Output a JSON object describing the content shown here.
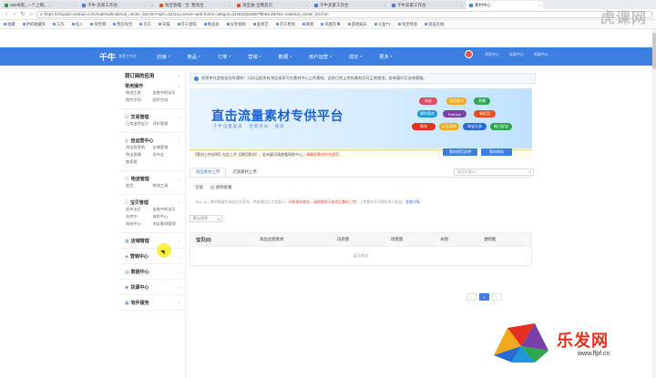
{
  "browser": {
    "tabs": [
      {
        "label": "360导航_一个上网，..",
        "color": "#2b9b3a",
        "active": false
      },
      {
        "label": "千牛-卖家工作台",
        "color": "#3d7fe0",
        "active": false
      },
      {
        "label": "淘宝管理 - 宝: 我淘宝",
        "color": "#e6501f",
        "active": false
      },
      {
        "label": "淘宝通-全网首页",
        "color": "#e6501f",
        "active": false
      },
      {
        "label": "千牛卖家工作台",
        "color": "#3d7fe0",
        "active": false
      },
      {
        "label": "千牛卖家工作台",
        "color": "#3d7fe0",
        "active": false
      },
      {
        "label": "素材中心",
        "color": "#3d7fe0",
        "active": true
      }
    ],
    "url": "https://zhiqulxin.taobao.com/material/material_center_list.htm?spm=a211vu.server-web-home.category.d12622d2d387f8b5a.Z8rf4e=material_center_list.htm",
    "bookmarks": [
      "收藏",
      "手机收藏夹",
      "工作",
      "电入",
      "淘宝网",
      "我的淘宝",
      "京东",
      "天猫",
      "苏宁易购",
      "唯品会",
      "分享视频",
      "爱奇艺",
      "苏宁易购",
      "网易",
      "凤凰军事",
      "游戏娱乐",
      "斗鱼TV",
      "淘宝特卖",
      "国美在线"
    ]
  },
  "app": {
    "logo": "千牛",
    "logo_sub": "卖家工作台",
    "nav": [
      "店铺",
      "商品",
      "订单",
      "营销",
      "数据",
      "用户运营",
      "成长",
      "更多"
    ],
    "right_links": [
      "消息中心",
      "卖家中心",
      "帮助中心"
    ]
  },
  "sidebar": {
    "head": "我订阅的应用",
    "groups": [
      {
        "title": "常用操作",
        "icon": "",
        "links": [
          "物流工具",
          "出售中的宝贝",
          "图片空间",
          "图片空间"
        ]
      },
      {
        "title": "交易管理",
        "icon": "☷",
        "links": [
          "已卖出的宝贝",
          "评价管理"
        ]
      },
      {
        "title": "自运营中心",
        "icon": "◎",
        "links": [
          "淘宝群营销",
          "店铺营销",
          "淘宝直播",
          "发布会",
          "商家群"
        ]
      },
      {
        "title": "物流管理",
        "icon": "▭",
        "links": [
          "发货",
          "物流工具"
        ]
      },
      {
        "title": "宝贝管理",
        "icon": "◇",
        "links": [
          "发布宝贝",
          "出售中的宝贝",
          "仓库中",
          "体检中心",
          "体检中心",
          "淘宝素材管理"
        ]
      },
      {
        "title": "店铺管理",
        "icon": "▦",
        "links": []
      },
      {
        "title": "营销中心",
        "icon": "◈",
        "links": []
      },
      {
        "title": "数据中心",
        "icon": "▤",
        "links": []
      },
      {
        "title": "货源中心",
        "icon": "◉",
        "links": []
      },
      {
        "title": "软件服务",
        "icon": "▣",
        "links": []
      }
    ]
  },
  "main": {
    "notice": "很荣幸在此推送及时通知！1月5日起所有淘宝卖家可在素材中心上传素材，此前已经上传的素材仍可正常使用，若有疑问可咨询客服。",
    "banner_title": "直击流量素材专供平台",
    "banner_sub": "千牛流量渠道 · 营销活动 · 搜索",
    "banner_pills": [
      "淘宝",
      "首页焦点",
      "直播",
      "Fashion",
      "有好货",
      "猜你喜欢",
      "微淘",
      "必买清单",
      "淘宝头条",
      "每日好店"
    ],
    "hint_prefix": "【素材上传说明】",
    "hint_text": "在此上传【通用素材】，若有疑问请查看帮助中心；",
    "hint_red": "请确保素材符合规范",
    "hint_buttons": [
      "素材规范说明",
      "素材审核"
    ],
    "tabs": [
      "商品素材上传",
      "店铺素材上传"
    ],
    "search_placeholder": "商品标题/ID",
    "filter_label": "全部",
    "filter_option": "请你查看",
    "tips_a": "Tips: 以上素材需要在淘宝后台发布，审核通过后才会展示；",
    "tips_red": "如有素材被拒，请按照提示修改后重新上传；",
    "tips_b": "上传素材不可侵犯他人权益；",
    "tips_blue": "查看详情",
    "sort_label": "默认排序",
    "table_headers": [
      "宝贝(0)",
      "商品主图素材",
      "白底图",
      "场景图",
      "长图",
      "透明图"
    ],
    "empty_text": "暂无数据",
    "pager": [
      "‹",
      "1",
      "›"
    ]
  },
  "watermarks": {
    "top": "虎课网",
    "brand": "乐发网",
    "url": "www.lfpf.cn"
  }
}
